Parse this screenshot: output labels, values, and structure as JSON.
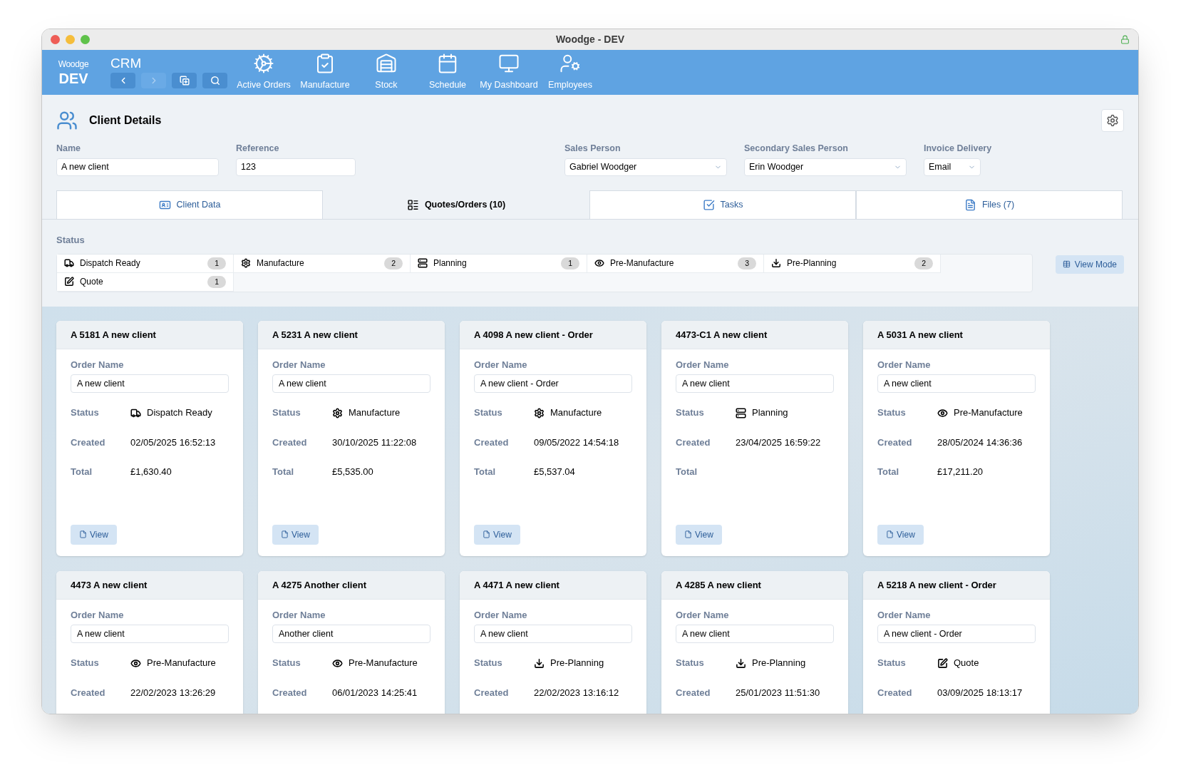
{
  "window": {
    "title": "Woodge - DEV"
  },
  "toolbar": {
    "logo_top": "Woodge",
    "logo_bottom": "DEV",
    "app": "CRM",
    "nav_buttons": [
      {
        "kind": "back",
        "disabled": false
      },
      {
        "kind": "forward",
        "disabled": true
      },
      {
        "kind": "new",
        "disabled": false
      },
      {
        "kind": "search",
        "disabled": false
      }
    ],
    "items": [
      {
        "kind": "saw",
        "label": "Active Orders"
      },
      {
        "kind": "clipboard",
        "label": "Manufacture"
      },
      {
        "kind": "stock",
        "label": "Stock"
      },
      {
        "kind": "calendar",
        "label": "Schedule"
      },
      {
        "kind": "monitor",
        "label": "My Dashboard"
      },
      {
        "kind": "employee",
        "label": "Employees"
      }
    ]
  },
  "header": {
    "title": "Client Details"
  },
  "fields": [
    {
      "label": "Name",
      "value": "A new client",
      "kind": "text"
    },
    {
      "label": "Reference",
      "value": "123",
      "kind": "text"
    },
    {
      "label": "Sales Person",
      "value": "Gabriel Woodger",
      "kind": "select"
    },
    {
      "label": "Secondary Sales Person",
      "value": "Erin Woodger",
      "kind": "select"
    },
    {
      "label": "Invoice Delivery",
      "value": "Email",
      "kind": "select"
    }
  ],
  "tabs": [
    {
      "kind": "client",
      "label": "Client Data",
      "selected": false
    },
    {
      "kind": "orders",
      "label": "Quotes/Orders (10)",
      "selected": true
    },
    {
      "kind": "tasks",
      "label": "Tasks",
      "selected": false
    },
    {
      "kind": "files",
      "label": "Files (7)",
      "selected": false
    }
  ],
  "status": {
    "title": "Status",
    "items": [
      {
        "kind": "dispatch",
        "label": "Dispatch Ready",
        "count": "1"
      },
      {
        "kind": "manufacture",
        "label": "Manufacture",
        "count": "2"
      },
      {
        "kind": "planning",
        "label": "Planning",
        "count": "1"
      },
      {
        "kind": "premanufacture",
        "label": "Pre-Manufacture",
        "count": "3"
      },
      {
        "kind": "preplanning",
        "label": "Pre-Planning",
        "count": "2"
      },
      {
        "kind": "quote",
        "label": "Quote",
        "count": "1"
      }
    ],
    "view_mode": "View Mode"
  },
  "cards": [
    {
      "title": "A 5181 A new client",
      "order_label": "Order Name",
      "order_name": "A new client",
      "status_label": "Status",
      "status": {
        "kind": "dispatch",
        "label": "Dispatch Ready"
      },
      "created_label": "Created",
      "created": "02/05/2025 16:52:13",
      "total_label": "Total",
      "total": "£1,630.40",
      "view": "View"
    },
    {
      "title": "A 5231 A new client",
      "order_label": "Order Name",
      "order_name": "A new client",
      "status_label": "Status",
      "status": {
        "kind": "manufacture",
        "label": "Manufacture"
      },
      "created_label": "Created",
      "created": "30/10/2025 11:22:08",
      "total_label": "Total",
      "total": "£5,535.00",
      "view": "View"
    },
    {
      "title": "A 4098 A new client - Order",
      "order_label": "Order Name",
      "order_name": "A new client - Order",
      "status_label": "Status",
      "status": {
        "kind": "manufacture",
        "label": "Manufacture"
      },
      "created_label": "Created",
      "created": "09/05/2022 14:54:18",
      "total_label": "Total",
      "total": "£5,537.04",
      "view": "View"
    },
    {
      "title": "4473-C1 A new client",
      "order_label": "Order Name",
      "order_name": "A new client",
      "status_label": "Status",
      "status": {
        "kind": "planning",
        "label": "Planning"
      },
      "created_label": "Created",
      "created": "23/04/2025 16:59:22",
      "total_label": "Total",
      "view": "View"
    },
    {
      "title": "A 5031 A new client",
      "order_label": "Order Name",
      "order_name": "A new client",
      "status_label": "Status",
      "status": {
        "kind": "premanufacture",
        "label": "Pre-Manufacture"
      },
      "created_label": "Created",
      "created": "28/05/2024 14:36:36",
      "total_label": "Total",
      "total": "£17,211.20",
      "view": "View"
    },
    {
      "title": "4473 A new client",
      "order_label": "Order Name",
      "order_name": "A new client",
      "status_label": "Status",
      "status": {
        "kind": "premanufacture",
        "label": "Pre-Manufacture"
      },
      "created_label": "Created",
      "created": "22/02/2023 13:26:29"
    },
    {
      "title": "A 4275 Another client",
      "order_label": "Order Name",
      "order_name": "Another client",
      "status_label": "Status",
      "status": {
        "kind": "premanufacture",
        "label": "Pre-Manufacture"
      },
      "created_label": "Created",
      "created": "06/01/2023 14:25:41"
    },
    {
      "title": "A 4471 A new client",
      "order_label": "Order Name",
      "order_name": "A new client",
      "status_label": "Status",
      "status": {
        "kind": "preplanning",
        "label": "Pre-Planning"
      },
      "created_label": "Created",
      "created": "22/02/2023 13:16:12"
    },
    {
      "title": "A 4285 A new client",
      "order_label": "Order Name",
      "order_name": "A new client",
      "status_label": "Status",
      "status": {
        "kind": "preplanning",
        "label": "Pre-Planning"
      },
      "created_label": "Created",
      "created": "25/01/2023 11:51:30"
    },
    {
      "title": "A 5218 A new client - Order",
      "order_label": "Order Name",
      "order_name": "A new client - Order",
      "status_label": "Status",
      "status": {
        "kind": "quote",
        "label": "Quote"
      },
      "created_label": "Created",
      "created": "03/09/2025 18:13:17"
    }
  ]
}
